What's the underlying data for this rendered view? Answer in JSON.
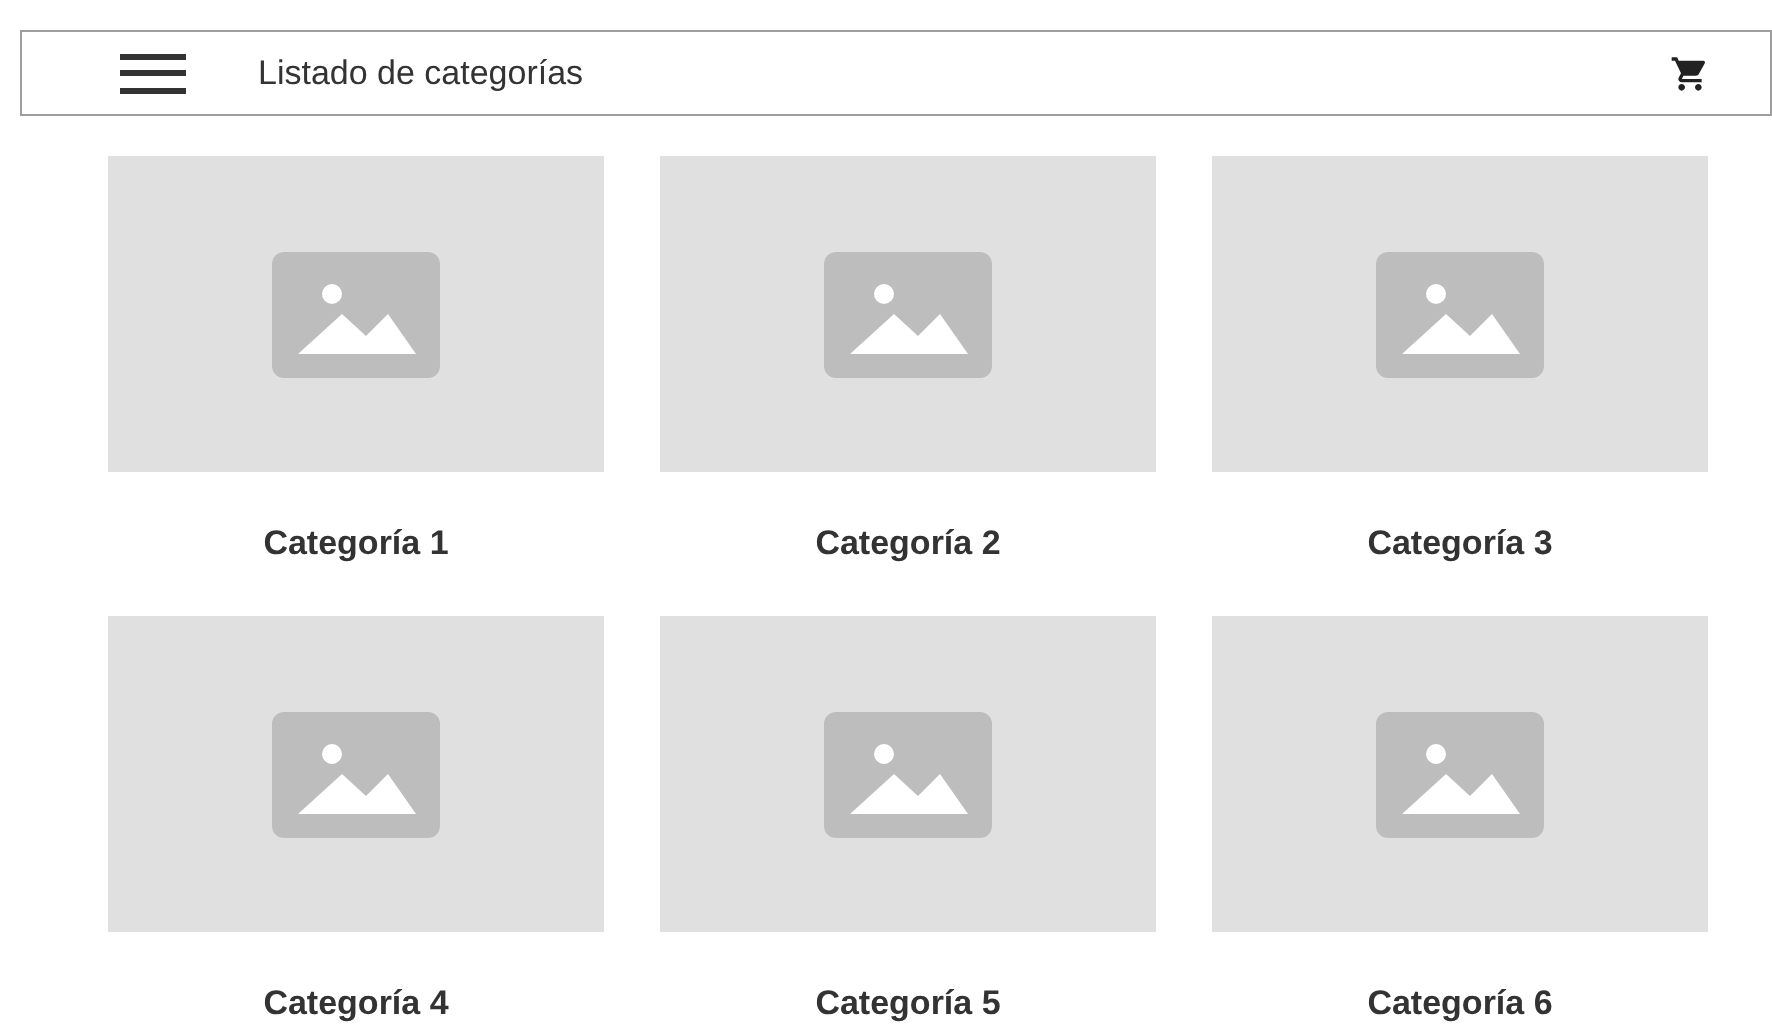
{
  "header": {
    "title": "Listado de categorías"
  },
  "categories": [
    {
      "name": "Categoría 1"
    },
    {
      "name": "Categoría 2"
    },
    {
      "name": "Categoría 3"
    },
    {
      "name": "Categoría 4"
    },
    {
      "name": "Categoría 5"
    },
    {
      "name": "Categoría 6"
    }
  ]
}
